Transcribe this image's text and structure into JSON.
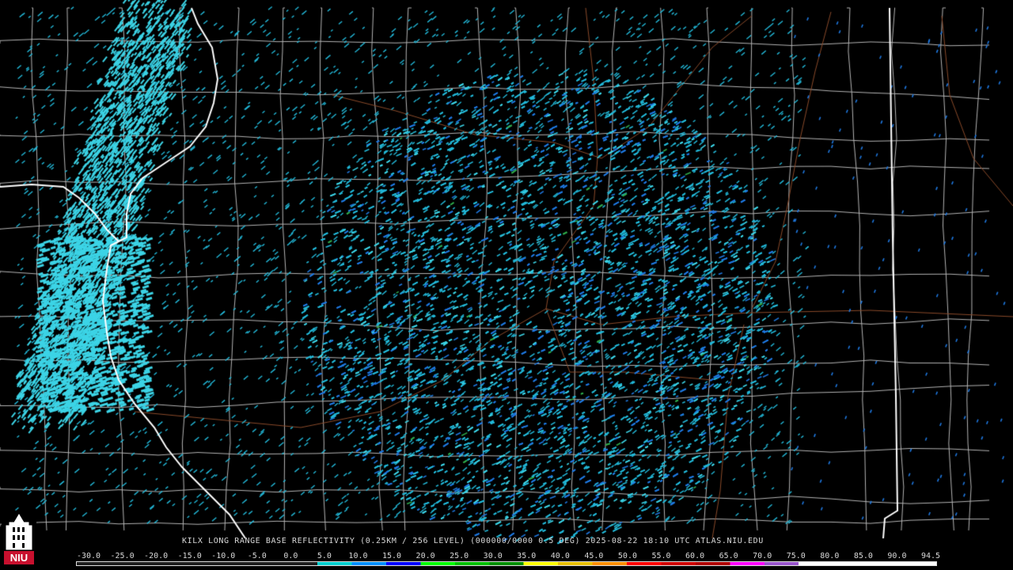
{
  "caption": "KILX LONG RANGE BASE REFLECTIVITY (0.25KM / 256 LEVEL) (000000/0000 0.5 DEG) 2025-08-22 18:10 UTC  ATLAS.NIU.EDU",
  "logo": {
    "icon": "niu-logo-icon",
    "text": "NIU",
    "color": "#c8102e"
  },
  "scale": {
    "ticks": [
      "-30.0",
      "-25.0",
      "-20.0",
      "-15.0",
      "-10.0",
      "-5.0",
      "0.0",
      "5.0",
      "10.0",
      "15.0",
      "20.0",
      "25.0",
      "30.0",
      "35.0",
      "40.0",
      "45.0",
      "50.0",
      "55.0",
      "60.0",
      "65.0",
      "70.0",
      "75.0",
      "80.0",
      "85.0",
      "90.0",
      "94.5"
    ],
    "colors": [
      "#1e1e1e",
      "#1e1e1e",
      "#1e1e1e",
      "#1e1e1e",
      "#1e1e1e",
      "#1e1e1e",
      "#1e1e1e",
      "#00d0d0",
      "#0090ff",
      "#0000ff",
      "#00ff00",
      "#00c000",
      "#009000",
      "#ffff00",
      "#e8c000",
      "#ff9000",
      "#ff0000",
      "#d00000",
      "#b00000",
      "#ff00ff",
      "#9955cc",
      "#ffffff",
      "#ffffff",
      "#ffffff",
      "#ffffff"
    ]
  },
  "map_colors": {
    "state_border": "#ffffff",
    "county_border": "#b4b4b4",
    "highway": "#8a4a2a",
    "echo_light": "#22b8d8",
    "echo_cyan": "#3cd4e6",
    "echo_blue": "#1e78e0",
    "echo_green": "#2ea84a"
  }
}
